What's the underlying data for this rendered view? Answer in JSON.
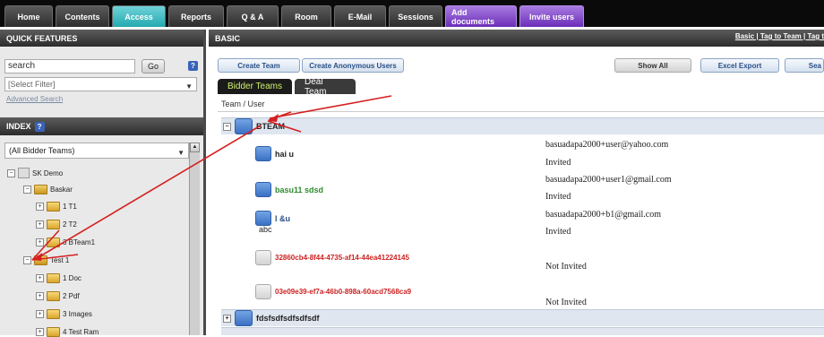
{
  "topnav": {
    "tabs": [
      "Home",
      "Contents",
      "Access",
      "Reports",
      "Q & A",
      "Room",
      "E-Mail",
      "Sessions",
      "Add documents",
      "Invite users"
    ]
  },
  "quick": {
    "title": "QUICK FEATURES",
    "search_value": "search",
    "go_label": "Go",
    "help": "?",
    "filter_value": "[Select Filter]",
    "advanced_label": "Advanced Search"
  },
  "index": {
    "title": "INDEX",
    "help": "?",
    "team_select": "(All Bidder Teams)"
  },
  "tree": {
    "root": "SK Demo",
    "nodes": [
      "Baskar",
      "1 T1",
      "2 T2",
      "3 BTeam1",
      "Test 1",
      "1 Doc",
      "2 Pdf",
      "3 Images",
      "4 Test Ram"
    ]
  },
  "main": {
    "title": "BASIC",
    "links": "Basic | Tag to Team | Tag t",
    "buttons": {
      "create_team": "Create Team",
      "create_anon": "Create Anonymous Users",
      "show_all": "Show All",
      "excel_export": "Excel Export",
      "search": "Sea"
    },
    "subtabs": {
      "bidder": "Bidder Teams",
      "deal": "Deal Team"
    },
    "column_header": "Team / User",
    "teams": [
      {
        "name": "BTEAM"
      },
      {
        "name": "fdsfsdfsdfsdfsdf"
      }
    ],
    "users": [
      {
        "name": "hai u",
        "email": "basuadapa2000+user@yahoo.com",
        "status": "Invited",
        "color": "#222222"
      },
      {
        "name": "basu11 sdsd",
        "email": "basuadapa2000+user1@gmail.com",
        "status": "Invited",
        "color": "#2e8a2e"
      },
      {
        "name": "l &u",
        "sub": "abc",
        "email": "basuadapa2000+b1@gmail.com",
        "status": "Invited",
        "color": "#2a4f86"
      },
      {
        "name": "32860cb4-8f44-4735-af14-44ea41224145",
        "email": "",
        "status": "Not Invited",
        "color": "#cc2222"
      },
      {
        "name": "03e09e39-ef7a-46b0-898a-60acd7568ca9",
        "email": "",
        "status": "Not Invited",
        "color": "#cc2222"
      }
    ]
  },
  "colors": {
    "accent": "#2aa9b0",
    "purple": "#7c3cc2",
    "arrow": "#d42020"
  }
}
